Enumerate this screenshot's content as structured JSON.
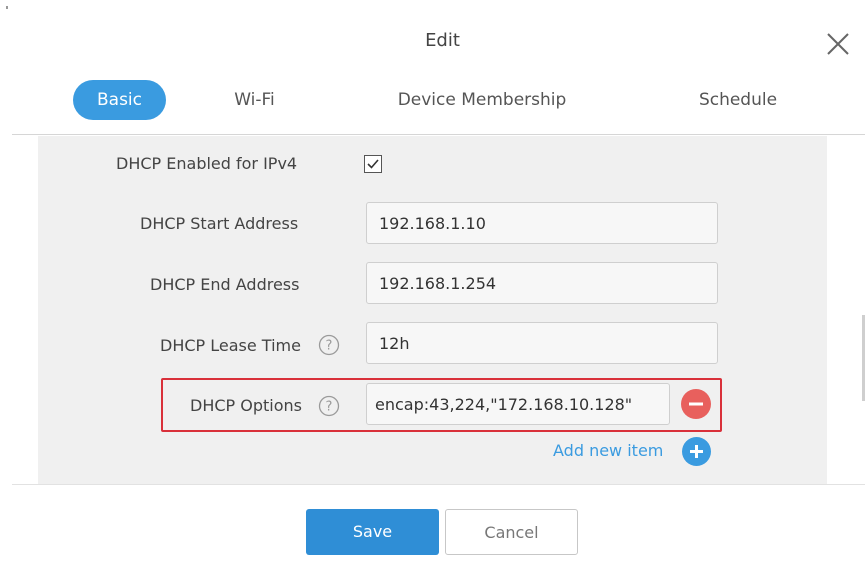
{
  "dialog": {
    "title": "Edit"
  },
  "tabs": [
    {
      "label": "Basic",
      "active": true
    },
    {
      "label": "Wi-Fi",
      "active": false
    },
    {
      "label": "Device Membership",
      "active": false
    },
    {
      "label": "Schedule",
      "active": false
    }
  ],
  "form": {
    "dhcp_enabled": {
      "label": "DHCP Enabled for IPv4",
      "checked": true
    },
    "start_address": {
      "label": "DHCP Start Address",
      "value": "192.168.1.10"
    },
    "end_address": {
      "label": "DHCP End Address",
      "value": "192.168.1.254"
    },
    "lease_time": {
      "label": "DHCP Lease Time",
      "value": "12h"
    },
    "options": {
      "label": "DHCP Options",
      "value": "encap:43,224,\"172.168.10.128\""
    },
    "add_new_item": "Add new item"
  },
  "buttons": {
    "save": "Save",
    "cancel": "Cancel"
  },
  "colors": {
    "accent": "#3a9be0",
    "save_button": "#2f8ed6",
    "remove_button": "#e8605d",
    "highlight": "#d9303a",
    "panel_background": "#f0f0f0"
  },
  "icons": [
    "close-icon",
    "checkmark-icon",
    "help-icon",
    "minus-icon",
    "plus-icon"
  ]
}
